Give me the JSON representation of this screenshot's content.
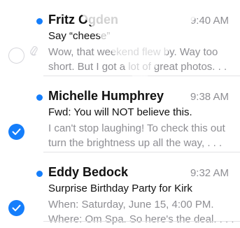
{
  "messages": [
    {
      "sender": "Fritz Ogden",
      "time": "9:40 AM",
      "subject": "Say “cheese”",
      "preview_line1": "Wow, that weekend flew by. Way too",
      "preview_line2": "short. But I got a lot of great photos. . .",
      "unread": true,
      "selected": false,
      "has_attachment": true
    },
    {
      "sender": "Michelle Humphrey",
      "time": "9:38 AM",
      "subject": "Fwd: You will NOT believe this.",
      "preview_line1": "I can't stop laughing! To check this out",
      "preview_line2": "turn the brightness up all the way, . . .",
      "unread": true,
      "selected": true,
      "has_attachment": false
    },
    {
      "sender": "Eddy Bedock",
      "time": "9:32 AM",
      "subject": "Surprise Birthday Party for Kirk",
      "preview_line1": "When: Saturday, June 15, 4:00 PM.",
      "preview_line2": "Where: Om Spa. So here's the deal. . . .",
      "unread": true,
      "selected": true,
      "has_attachment": false
    }
  ],
  "colors": {
    "accent": "#157efb",
    "secondary_text": "#8e8e93",
    "primary_text": "#111111",
    "separator": "#e3e3e6"
  },
  "icons": {
    "unread": "unread-dot-icon",
    "selected": "checkmark-circle-icon",
    "unselected": "empty-circle-icon",
    "attachment": "paperclip-icon"
  }
}
